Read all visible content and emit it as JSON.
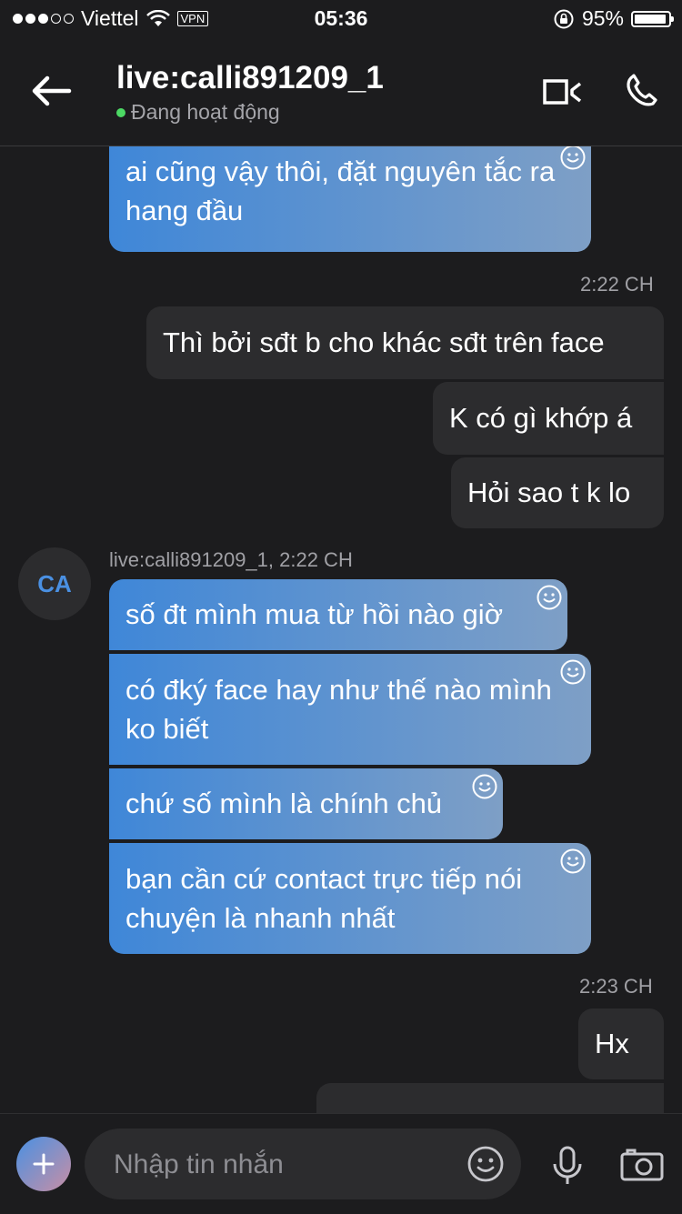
{
  "status_bar": {
    "carrier": "Viettel",
    "vpn": "VPN",
    "time": "05:36",
    "battery": "95%",
    "battery_level": 0.95
  },
  "header": {
    "title": "live:calli891209_1",
    "presence": "Đang hoạt động"
  },
  "messages": {
    "recv_top": "ai cũng vậy thôi, đặt nguyên tắc ra hang đầu",
    "ts_1": "2:22 CH",
    "sent_1": "Thì bởi sđt b cho khác sđt trên face",
    "sent_2": "K có gì khớp á",
    "sent_3": "Hỏi sao t k lo",
    "avatar": "CA",
    "sender_line": "live:calli891209_1, 2:22 CH",
    "recv_1": "số đt mình mua từ hồi nào giờ",
    "recv_2": "có đký face hay như thế nào mình ko biết",
    "recv_3": "chứ số mình là chính chủ",
    "recv_4": "bạn cần cứ contact trực tiếp nói chuyện là nhanh nhất",
    "ts_2": "2:23 CH",
    "sent_4": "Hx"
  },
  "composer": {
    "placeholder": "Nhập tin nhắn"
  },
  "colors": {
    "background": "#1c1c1e",
    "sent_bubble": "#2c2c2e",
    "recv_start": "#3f87d8",
    "recv_end": "#7e9fc6",
    "online": "#4cd964"
  }
}
